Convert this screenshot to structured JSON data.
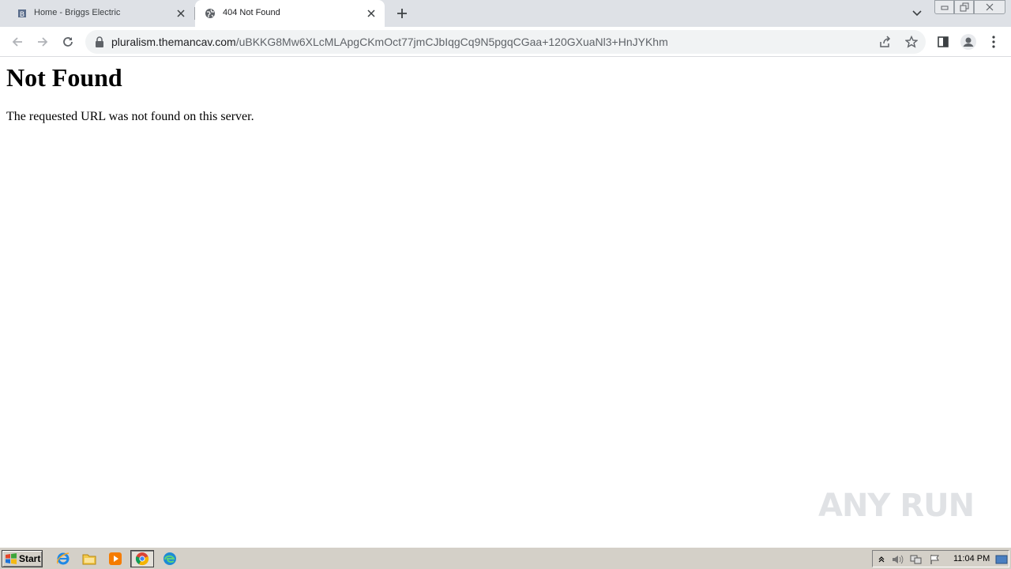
{
  "browser": {
    "tabs": [
      {
        "title": "Home - Briggs Electric",
        "active": false
      },
      {
        "title": "404 Not Found",
        "active": true
      }
    ],
    "url_host": "pluralism.themancav.com",
    "url_path": "/uBKKG8Mw6XLcMLApgCKmOct77jmCJbIqgCq9N5pgqCGaa+120GXuaNl3+HnJYKhm"
  },
  "page": {
    "heading": "Not Found",
    "message": "The requested URL was not found on this server."
  },
  "watermark": "ANY RUN",
  "taskbar": {
    "start_label": "Start",
    "clock": "11:04 PM"
  },
  "colors": {
    "tabstrip": "#dee1e6",
    "omnibox": "#f1f3f4",
    "taskbar": "#d4d0c8"
  }
}
